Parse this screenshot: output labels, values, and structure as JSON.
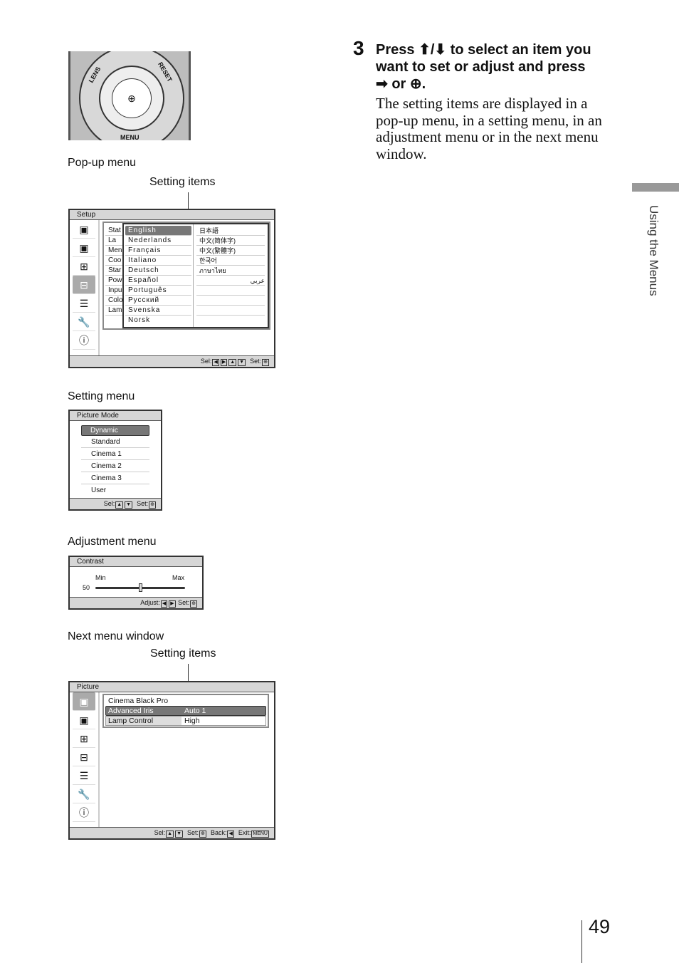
{
  "remote": {
    "lens": "LENS",
    "reset": "RESET",
    "menu": "MENU",
    "center": "⊕"
  },
  "labels": {
    "popup": "Pop-up menu",
    "setting_items_1": "Setting items",
    "setting_menu": "Setting menu",
    "adjustment_menu": "Adjustment menu",
    "next_menu": "Next menu window",
    "setting_items_2": "Setting items"
  },
  "popup": {
    "title": "Setup",
    "items": [
      "Stat",
      "La",
      "Men",
      "Coo",
      "Star",
      "Pow",
      "Inpu",
      "Colo",
      "Lam"
    ],
    "languages_left": [
      "English",
      "Nederlands",
      "Français",
      "Italiano",
      "Deutsch",
      "Español",
      "Português",
      "Русский",
      "Svenska",
      "Norsk"
    ],
    "languages_right": [
      "日本語",
      "中文(简体字)",
      "中文(繁體字)",
      "한국어",
      "ภาษาไทย",
      "عربي",
      "",
      "",
      "",
      ""
    ],
    "footer": {
      "sel": "Sel:",
      "set": "Set:"
    }
  },
  "sidebar_icons": [
    "picture-icon",
    "advanced-picture-icon",
    "screen-icon",
    "setup-icon",
    "function-icon",
    "installation-icon",
    "information-icon"
  ],
  "setting": {
    "title": "Picture Mode",
    "items": [
      "Dynamic",
      "Standard",
      "Cinema 1",
      "Cinema 2",
      "Cinema 3",
      "User"
    ],
    "footer": {
      "sel": "Sel:",
      "set": "Set:"
    }
  },
  "adjust": {
    "title": "Contrast",
    "min": "Min",
    "max": "Max",
    "value": "50",
    "level": 0.5,
    "footer": {
      "adjust": "Adjust:",
      "set": "Set:"
    }
  },
  "next": {
    "title": "Picture",
    "rows": [
      {
        "label": "Cinema Black Pro",
        "value": ""
      },
      {
        "label": "Advanced Iris",
        "value": "Auto 1"
      },
      {
        "label": "Lamp Control",
        "value": "High"
      }
    ],
    "footer": {
      "sel": "Sel:",
      "set": "Set:",
      "back": "Back:",
      "exit": "Exit:",
      "menu_key": "MENU"
    }
  },
  "step": {
    "number": "3",
    "heading_1": "Press ",
    "heading_arrows": "⬆/⬇",
    "heading_2": " to select an item you want to set or adjust and press",
    "heading_arrow_right": "➡",
    "heading_or": " or ",
    "heading_enter": "⊕",
    "heading_end": ".",
    "body": "The setting items are displayed in a pop-up menu, in a setting menu, in an adjustment menu or in the next menu window."
  },
  "side_tab": "Using the Menus",
  "page_number": "49"
}
